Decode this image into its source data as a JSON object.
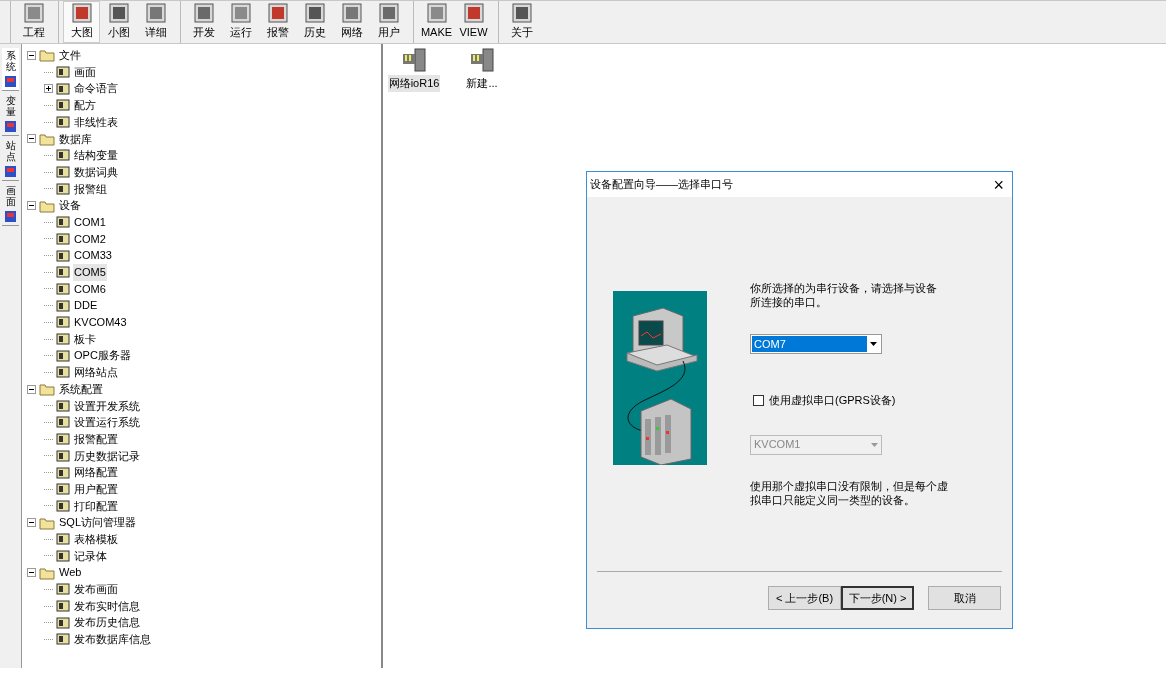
{
  "toolbar": {
    "groups": [
      [
        {
          "label": "工程",
          "selected": false
        }
      ],
      [
        {
          "label": "大图",
          "selected": true
        },
        {
          "label": "小图",
          "selected": false
        },
        {
          "label": "详细",
          "selected": false
        }
      ],
      [
        {
          "label": "开发",
          "selected": false
        },
        {
          "label": "运行",
          "selected": false
        },
        {
          "label": "报警",
          "selected": false
        },
        {
          "label": "历史",
          "selected": false
        },
        {
          "label": "网络",
          "selected": false
        },
        {
          "label": "用户",
          "selected": false
        }
      ],
      [
        {
          "label": "MAKE",
          "selected": false
        },
        {
          "label": "VIEW",
          "selected": false
        }
      ],
      [
        {
          "label": "关于",
          "selected": false
        }
      ]
    ]
  },
  "side_tabs": [
    {
      "label": "系统",
      "selected": true
    },
    {
      "label": "变量",
      "selected": false
    },
    {
      "label": "站点",
      "selected": false
    },
    {
      "label": "画面",
      "selected": false
    }
  ],
  "tree": [
    {
      "label": "文件",
      "expanded": true,
      "selected": false,
      "children": [
        {
          "label": "画面",
          "selected": false
        },
        {
          "label": "命令语言",
          "selected": false,
          "expanded": false
        },
        {
          "label": "配方",
          "selected": false
        },
        {
          "label": "非线性表",
          "selected": false
        }
      ]
    },
    {
      "label": "数据库",
      "expanded": true,
      "selected": false,
      "children": [
        {
          "label": "结构变量",
          "selected": false
        },
        {
          "label": "数据词典",
          "selected": false
        },
        {
          "label": "报警组",
          "selected": false
        }
      ]
    },
    {
      "label": "设备",
      "expanded": true,
      "selected": false,
      "children": [
        {
          "label": "COM1",
          "selected": false
        },
        {
          "label": "COM2",
          "selected": false
        },
        {
          "label": "COM33",
          "selected": false
        },
        {
          "label": "COM5",
          "selected": true
        },
        {
          "label": "COM6",
          "selected": false
        },
        {
          "label": "DDE",
          "selected": false
        },
        {
          "label": "KVCOM43",
          "selected": false
        },
        {
          "label": "板卡",
          "selected": false
        },
        {
          "label": "OPC服务器",
          "selected": false
        },
        {
          "label": "网络站点",
          "selected": false
        }
      ]
    },
    {
      "label": "系统配置",
      "expanded": true,
      "selected": false,
      "children": [
        {
          "label": "设置开发系统",
          "selected": false
        },
        {
          "label": "设置运行系统",
          "selected": false
        },
        {
          "label": "报警配置",
          "selected": false
        },
        {
          "label": "历史数据记录",
          "selected": false
        },
        {
          "label": "网络配置",
          "selected": false
        },
        {
          "label": "用户配置",
          "selected": false
        },
        {
          "label": "打印配置",
          "selected": false
        }
      ]
    },
    {
      "label": "SQL访问管理器",
      "expanded": true,
      "selected": false,
      "children": [
        {
          "label": "表格模板",
          "selected": false
        },
        {
          "label": "记录体",
          "selected": false
        }
      ]
    },
    {
      "label": "Web",
      "expanded": true,
      "selected": false,
      "children": [
        {
          "label": "发布画面",
          "selected": false
        },
        {
          "label": "发布实时信息",
          "selected": false
        },
        {
          "label": "发布历史信息",
          "selected": false
        },
        {
          "label": "发布数据库信息",
          "selected": false
        }
      ]
    }
  ],
  "devices": [
    {
      "label": "网络ioR16",
      "selected": true
    },
    {
      "label": "新建...",
      "selected": false
    }
  ],
  "dialog": {
    "title": "设备配置向导——选择串口号",
    "close": "×",
    "intro": "你所选择的为串行设备，请选择与设备所连接的串口。",
    "port": {
      "value": "COM7",
      "selected": true
    },
    "virtual_checkbox": {
      "label": "使用虚拟串口(GPRS设备)",
      "checked": false
    },
    "virtual_port": {
      "value": "KVCOM1",
      "disabled": true
    },
    "note": "使用那个虚拟串口没有限制，但是每个虚拟串口只能定义同一类型的设备。",
    "buttons": [
      {
        "label": "< 上一步(B)",
        "default": false
      },
      {
        "label": "下一步(N) >",
        "default": true
      },
      {
        "label": "取消",
        "default": false
      }
    ]
  }
}
